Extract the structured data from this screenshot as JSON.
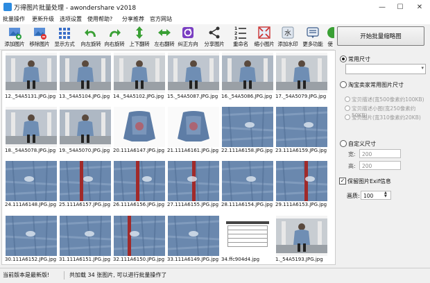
{
  "window": {
    "title": "万得图片批量处理 - awondershare v2018",
    "minimize": "—",
    "maximize": "☐",
    "close": "✕"
  },
  "menu": [
    "批量操作",
    "更新升级",
    "选项设置",
    "使用帮助?",
    "分享推荐",
    "官方网站"
  ],
  "toolbar": [
    {
      "label": "添加图片",
      "icon": "add-image-icon"
    },
    {
      "label": "移除图片",
      "icon": "remove-image-icon"
    },
    {
      "label": "显示方式",
      "icon": "display-mode-icon"
    },
    {
      "label": "向左旋转",
      "icon": "rotate-left-icon"
    },
    {
      "label": "向右旋转",
      "icon": "rotate-right-icon"
    },
    {
      "label": "上下翻转",
      "icon": "flip-vertical-icon"
    },
    {
      "label": "左右翻转",
      "icon": "flip-horizontal-icon"
    },
    {
      "label": "纠正方向",
      "icon": "correct-orientation-icon"
    },
    {
      "label": "分享图片",
      "icon": "share-icon"
    },
    {
      "label": "重命名",
      "icon": "rename-icon"
    },
    {
      "label": "缩小图片",
      "icon": "shrink-image-icon"
    },
    {
      "label": "添加水印",
      "icon": "watermark-icon"
    },
    {
      "label": "更多功能",
      "icon": "more-features-icon"
    },
    {
      "label": "使",
      "icon": "use-icon"
    }
  ],
  "start_button": "开始批量缩略图",
  "size_panel": {
    "common_size_label": "常用尺寸",
    "common_size_value": "",
    "taobao_label": "淘宝卖家常用图片尺寸",
    "taobao_options": [
      "宝贝描述(宽500像素约100KB)",
      "宝贝描述小图(宽250像素约50KB)",
      "宝贝图片(宽310像素约20KB)"
    ],
    "custom_label": "自定义尺寸",
    "width_label": "宽:",
    "width_value": "200",
    "height_label": "高:",
    "height_value": "200",
    "exif_label": "保留图片Exif信息",
    "quality_label": "画质:",
    "quality_value": "100"
  },
  "thumbnails": [
    {
      "caption": "12._54A5131.JPG.jpg",
      "kind": "person"
    },
    {
      "caption": "13._54A5104.JPG.jpg",
      "kind": "person"
    },
    {
      "caption": "14._54A5102.JPG.jpg",
      "kind": "person"
    },
    {
      "caption": "15._54A5087.JPG.jpg",
      "kind": "person"
    },
    {
      "caption": "16._54A5086.JPG.jpg",
      "kind": "person"
    },
    {
      "caption": "17._54A5079.JPG.jpg",
      "kind": "person"
    },
    {
      "caption": "18._54A5078.JPG.jpg",
      "kind": "person"
    },
    {
      "caption": "19._54A5070.JPG.jpg",
      "kind": "person"
    },
    {
      "caption": "20.111A6147.JPG.jpg",
      "kind": "jacket-back"
    },
    {
      "caption": "21.111A6161.JPG.jpg",
      "kind": "jacket-back"
    },
    {
      "caption": "22.111A6158.JPG.jpg",
      "kind": "denim"
    },
    {
      "caption": "23.111A6159.JPG.jpg",
      "kind": "denim"
    },
    {
      "caption": "24.111A6148.JPG.jpg",
      "kind": "denim"
    },
    {
      "caption": "25.111A6157.JPG.jpg",
      "kind": "denim-red"
    },
    {
      "caption": "26.111A6156.JPG.jpg",
      "kind": "denim-red"
    },
    {
      "caption": "27.111A6155.JPG.jpg",
      "kind": "denim-red"
    },
    {
      "caption": "28.111A6154.JPG.jpg",
      "kind": "denim"
    },
    {
      "caption": "29.111A6153.JPG.jpg",
      "kind": "denim-red"
    },
    {
      "caption": "30.111A6152.JPG.jpg",
      "kind": "denim"
    },
    {
      "caption": "31.111A6151.JPG.jpg",
      "kind": "denim"
    },
    {
      "caption": "32.111A6150.JPG.jpg",
      "kind": "denim-red"
    },
    {
      "caption": "33.111A6149.JPG.jpg",
      "kind": "denim"
    },
    {
      "caption": "34.ffc904d4.jpg",
      "kind": "chart"
    },
    {
      "caption": "1._54A5193.JPG.jpg",
      "kind": "person"
    }
  ],
  "status": {
    "left": "当前版本是最新版!",
    "center": "共加载 34 张图片, 可以进行批量操作了"
  }
}
